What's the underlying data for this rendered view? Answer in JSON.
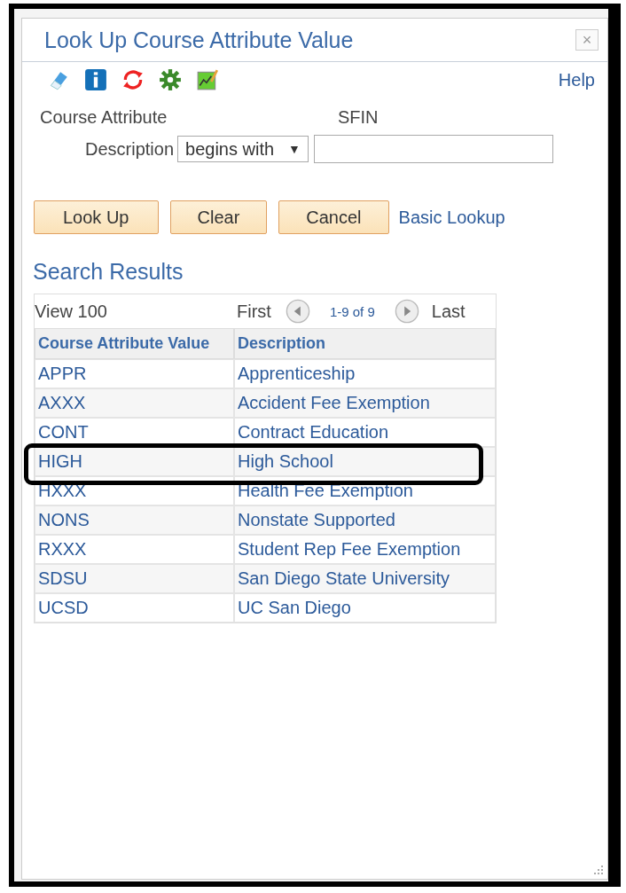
{
  "window": {
    "title": "Look Up Course Attribute Value",
    "close": "×"
  },
  "toolbar": {
    "help": "Help"
  },
  "fields": {
    "course_attribute_label": "Course Attribute",
    "course_attribute_value": "SFIN",
    "description_label": "Description",
    "operator": "begins with",
    "operator_caret": "▼"
  },
  "buttons": [
    "Look Up",
    "Clear",
    "Cancel"
  ],
  "basic_lookup": "Basic Lookup",
  "results": {
    "title": "Search Results",
    "view": "View 100",
    "first": "First",
    "range": "1-9 of 9",
    "last": "Last",
    "columns": [
      "Course Attribute Value",
      "Description"
    ],
    "rows": [
      {
        "value": "APPR",
        "description": "Apprenticeship",
        "highlighted": false
      },
      {
        "value": "AXXX",
        "description": "Accident Fee Exemption",
        "highlighted": false
      },
      {
        "value": "CONT",
        "description": "Contract Education",
        "highlighted": false
      },
      {
        "value": "HIGH",
        "description": "High School",
        "highlighted": true
      },
      {
        "value": "HXXX",
        "description": "Health Fee Exemption",
        "highlighted": false
      },
      {
        "value": "NONS",
        "description": "Nonstate Supported",
        "highlighted": false
      },
      {
        "value": "RXXX",
        "description": "Student Rep Fee Exemption",
        "highlighted": false
      },
      {
        "value": "SDSU",
        "description": "San Diego State University",
        "highlighted": false
      },
      {
        "value": "UCSD",
        "description": "UC San Diego",
        "highlighted": false
      }
    ]
  }
}
